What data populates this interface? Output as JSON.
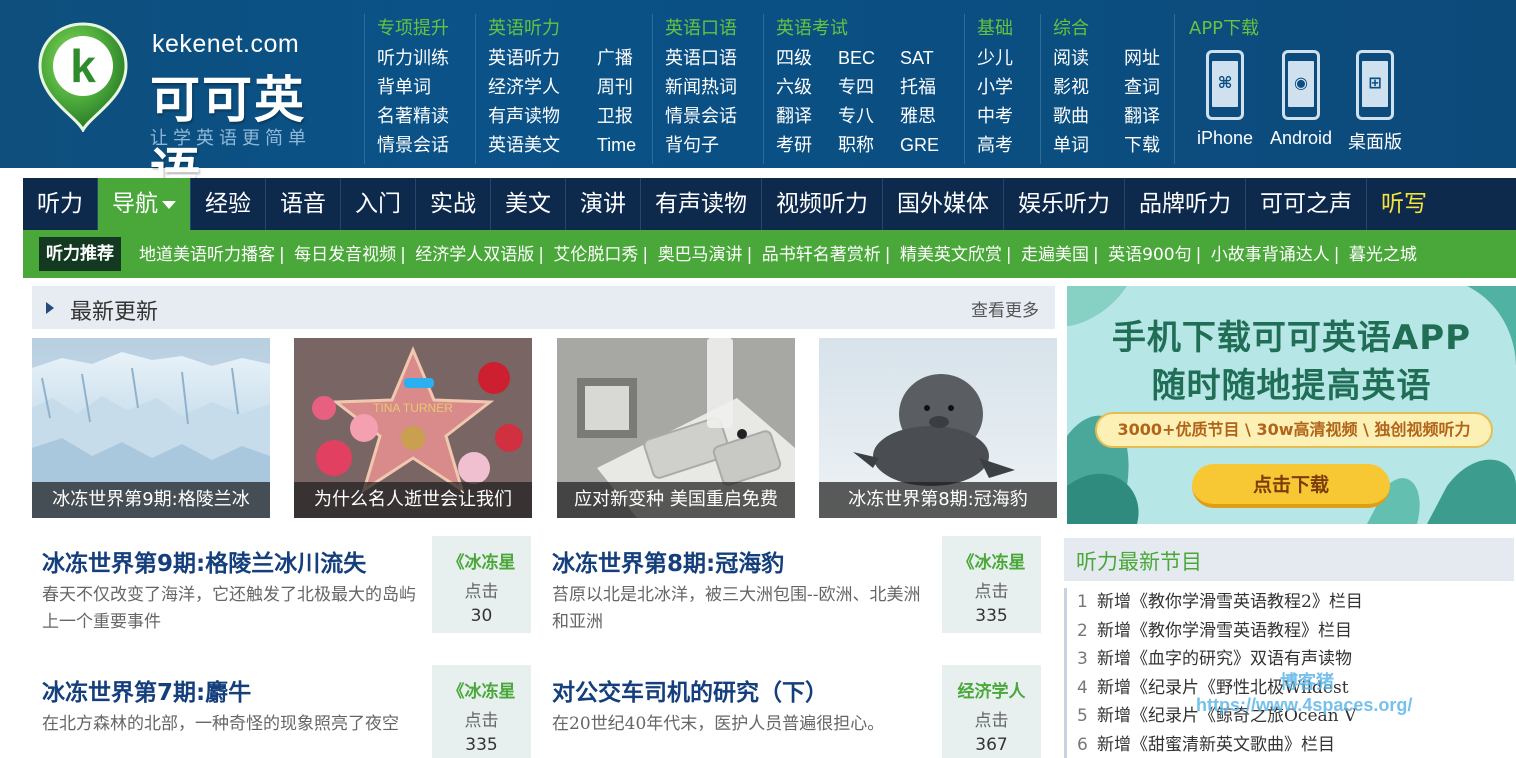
{
  "logo": {
    "letter": "k",
    "domain": "kekenet.com",
    "name": "可可英语",
    "slogan": "让学英语更简单"
  },
  "header_columns": [
    {
      "title": "专项提升",
      "items": [
        "听力训练",
        "背单词",
        "名著精读",
        "情景会话"
      ]
    },
    {
      "title": "英语听力",
      "items": [
        "英语听力",
        "广播",
        "经济学人",
        "周刊",
        "有声读物",
        "卫报",
        "英语美文",
        "Time"
      ]
    },
    {
      "title": "英语口语",
      "items": [
        "英语口语",
        "新闻热词",
        "情景会话",
        "背句子"
      ]
    },
    {
      "title": "英语考试",
      "items": [
        "四级",
        "BEC",
        "SAT",
        "六级",
        "专四",
        "托福",
        "翻译",
        "专八",
        "雅思",
        "考研",
        "职称",
        "GRE"
      ]
    },
    {
      "title": "基础",
      "items": [
        "少儿",
        "小学",
        "中考",
        "高考"
      ]
    },
    {
      "title": "综合",
      "items": [
        "阅读",
        "网址",
        "影视",
        "查词",
        "歌曲",
        "翻译",
        "单词",
        "下载"
      ]
    }
  ],
  "app": {
    "title": "APP下载",
    "items": [
      {
        "label": "iPhone",
        "icon": "apple-icon",
        "glyph": "⌘"
      },
      {
        "label": "Android",
        "icon": "android-icon",
        "glyph": "◉"
      },
      {
        "label": "桌面版",
        "icon": "windows-icon",
        "glyph": "⊞"
      }
    ]
  },
  "nav": {
    "items": [
      "听力",
      "导航",
      "经验",
      "语音",
      "入门",
      "实战",
      "美文",
      "演讲",
      "有声读物",
      "视频听力",
      "国外媒体",
      "娱乐听力",
      "品牌听力",
      "可可之声",
      "听写"
    ],
    "active": "导航",
    "highlight": "听写"
  },
  "recommend": {
    "tag": "听力推荐",
    "links": [
      "地道美语听力播客",
      "每日发音视频",
      "经济学人双语版",
      "艾伦脱口秀",
      "奥巴马演讲",
      "品书轩名著赏析",
      "精美英文欣赏",
      "走遍美国",
      "英语900句",
      "小故事背诵达人",
      "暮光之城"
    ]
  },
  "latest": {
    "title": "最新更新",
    "more": "查看更多",
    "thumbs": [
      {
        "caption": "冰冻世界第9期:格陵兰冰"
      },
      {
        "caption": "为什么名人逝世会让我们"
      },
      {
        "caption": "应对新变种 美国重启免费"
      },
      {
        "caption": "冰冻世界第8期:冠海豹"
      }
    ],
    "thumb_text": {
      "star_name": "TINA TURNER"
    },
    "articles": [
      {
        "title": "冰冻世界第9期:格陵兰冰川流失",
        "desc": "春天不仅改变了海洋，它还触发了北极最大的岛屿上一个重要事件",
        "column": "《冰冻星",
        "click_label": "点击",
        "clicks": "30"
      },
      {
        "title": "冰冻世界第8期:冠海豹",
        "desc": "苔原以北是北冰洋，被三大洲包围--欧洲、北美洲和亚洲",
        "column": "《冰冻星",
        "click_label": "点击",
        "clicks": "335"
      },
      {
        "title": "冰冻世界第7期:麝牛",
        "desc": "在北方森林的北部，一种奇怪的现象照亮了夜空",
        "column": "《冰冻星",
        "click_label": "点击",
        "clicks": "335"
      },
      {
        "title": "对公交车司机的研究（下）",
        "desc": "在20世纪40年代末，医护人员普遍很担心。",
        "column": "经济学人",
        "click_label": "点击",
        "clicks": "367"
      }
    ]
  },
  "banner": {
    "line1": "手机下载可可英语APP",
    "line2": "随时随地提高英语",
    "features": "3000+优质节目 \\ 30w高清视频 \\ 独创视频听力",
    "download": "点击下载"
  },
  "new_programs": {
    "title": "听力最新节目",
    "items": [
      {
        "n": "1",
        "text": "新增《教你学滑雪英语教程2》栏目"
      },
      {
        "n": "2",
        "text": "新增《教你学滑雪英语教程》栏目"
      },
      {
        "n": "3",
        "text": "新增《血字的研究》双语有声读物"
      },
      {
        "n": "4",
        "text": "新增《纪录片《野性北极Wildest"
      },
      {
        "n": "5",
        "text": "新增《纪录片《鲸奇之旅Ocean V"
      },
      {
        "n": "6",
        "text": "新增《甜蜜清新英文歌曲》栏目"
      }
    ]
  },
  "watermark": {
    "line1": "博客猪",
    "line2": "https://www.4spaces.org/"
  }
}
